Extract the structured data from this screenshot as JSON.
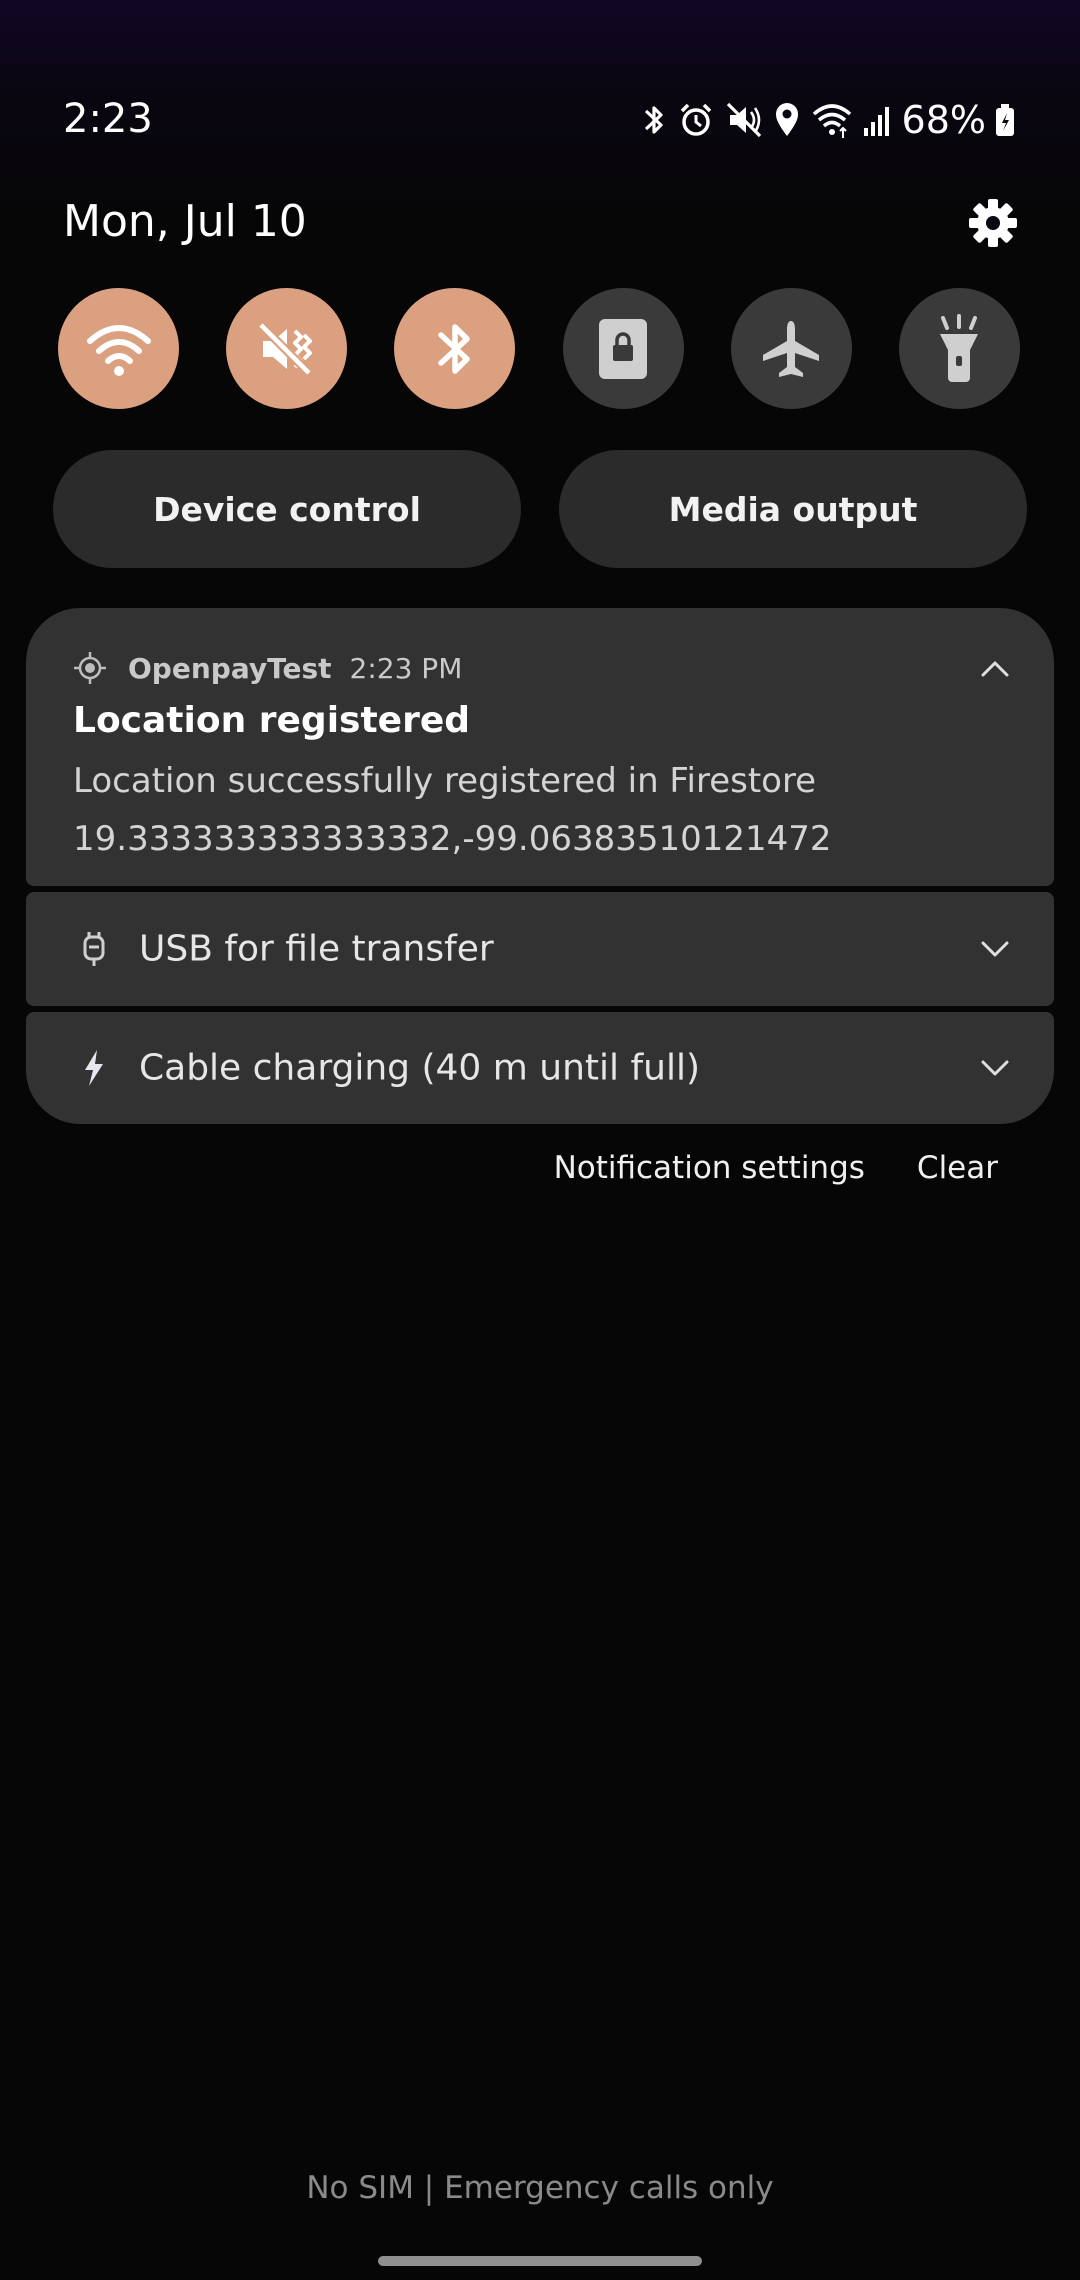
{
  "status_bar": {
    "time": "2:23",
    "battery": "68%",
    "icons": [
      "bluetooth-icon",
      "alarm-icon",
      "mute-icon",
      "location-icon",
      "wifi-icon",
      "signal-icon",
      "battery-icon"
    ]
  },
  "header": {
    "date": "Mon, Jul 10"
  },
  "quick_settings": [
    {
      "name": "wifi",
      "icon": "wifi-icon",
      "active": true
    },
    {
      "name": "sound",
      "icon": "mute-icon",
      "active": true
    },
    {
      "name": "bluetooth",
      "icon": "bluetooth-icon",
      "active": true
    },
    {
      "name": "rotation-lock",
      "icon": "lock-icon",
      "active": false
    },
    {
      "name": "airplane-mode",
      "icon": "airplane-icon",
      "active": false
    },
    {
      "name": "flashlight",
      "icon": "flashlight-icon",
      "active": false
    }
  ],
  "pills": {
    "device_control": "Device control",
    "media_output": "Media output"
  },
  "notification": {
    "app_name": "OpenpayTest",
    "time": "2:23 PM",
    "title": "Location registered",
    "body_line1": "Location successfully registered in Firestore",
    "body_line2": "19.333333333333332,-99.06383510121472"
  },
  "system_rows": {
    "usb": "USB for file transfer",
    "charging": "Cable charging (40 m until full)"
  },
  "actions": {
    "settings": "Notification settings",
    "clear": "Clear"
  },
  "footer": {
    "carrier": "No SIM | Emergency calls only"
  },
  "colors": {
    "accent_tile": "#dba07f",
    "inactive_tile": "#3a3a3a",
    "card": "#323232"
  }
}
